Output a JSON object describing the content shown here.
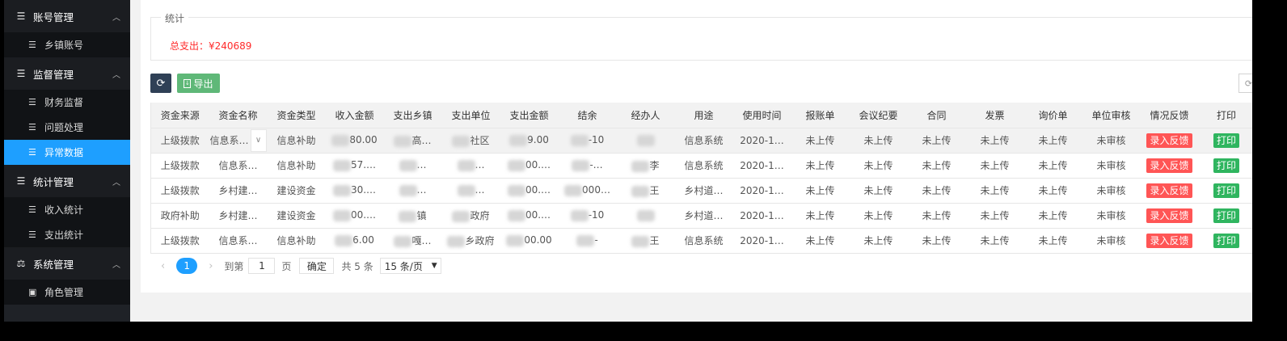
{
  "sidebar": {
    "groups": [
      {
        "label": "账号管理",
        "icon": "list-icon",
        "items": [
          {
            "label": "乡镇账号"
          }
        ]
      },
      {
        "label": "监督管理",
        "icon": "list-icon",
        "items": [
          {
            "label": "财务监督"
          },
          {
            "label": "问题处理"
          },
          {
            "label": "异常数据",
            "active": true
          }
        ]
      },
      {
        "label": "统计管理",
        "icon": "list-icon",
        "items": [
          {
            "label": "收入统计"
          },
          {
            "label": "支出统计"
          }
        ]
      },
      {
        "label": "系统管理",
        "icon": "balance-scale-icon",
        "items": [
          {
            "label": "角色管理"
          }
        ]
      }
    ]
  },
  "stats": {
    "legend": "统计",
    "total_expense": "总支出：¥240689"
  },
  "toolbar": {
    "export_label": "导出"
  },
  "table": {
    "columns": [
      "资金来源",
      "资金名称",
      "资金类型",
      "收入金额",
      "支出乡镇",
      "支出单位",
      "支出金额",
      "结余",
      "经办人",
      "用途",
      "使用时间",
      "报账单",
      "会议纪要",
      "合同",
      "发票",
      "询价单",
      "单位审核",
      "情况反馈",
      "打印"
    ],
    "rows": [
      [
        "上级拨款",
        "信息系…",
        "信息补助",
        "80.00",
        "高…",
        "社区",
        "9.00",
        "-10",
        "",
        "信息系统",
        "2020-1…",
        "未上传",
        "未上传",
        "未上传",
        "未上传",
        "未上传",
        "未审核",
        "录入反馈",
        "打印"
      ],
      [
        "上级拨款",
        "信息系…",
        "信息补助",
        "57.…",
        "…",
        "…",
        "00.…",
        "-…",
        "李",
        "信息系统",
        "2020-1…",
        "未上传",
        "未上传",
        "未上传",
        "未上传",
        "未上传",
        "未审核",
        "录入反馈",
        "打印"
      ],
      [
        "上级拨款",
        "乡村建…",
        "建设资金",
        "30.…",
        "…",
        "…",
        "00.…",
        "000…",
        "王",
        "乡村道…",
        "2020-1…",
        "未上传",
        "未上传",
        "未上传",
        "未上传",
        "未上传",
        "未审核",
        "录入反馈",
        "打印"
      ],
      [
        "政府补助",
        "乡村建…",
        "建设资金",
        "00.…",
        "镇",
        "政府",
        "00.…",
        "-10",
        "",
        "乡村道…",
        "2020-1…",
        "未上传",
        "未上传",
        "未上传",
        "未上传",
        "未上传",
        "未审核",
        "录入反馈",
        "打印"
      ],
      [
        "上级拨款",
        "信息系…",
        "信息补助",
        "6.00",
        "嘎…",
        "乡政府",
        "00.00",
        "-",
        "王",
        "信息系统",
        "2020-1…",
        "未上传",
        "未上传",
        "未上传",
        "未上传",
        "未上传",
        "未审核",
        "录入反馈",
        "打印"
      ]
    ]
  },
  "pager": {
    "current": "1",
    "goto_label": "到第",
    "goto_value": "1",
    "page_unit": "页",
    "confirm_label": "确定",
    "total_label": "共 5 条",
    "page_size": "15 条/页"
  },
  "colors": {
    "sidebar_bg": "#1f2227",
    "active": "#1e9fff",
    "total_text": "#ff2b2b",
    "feedback": "#ff5555",
    "print": "#2fb55f",
    "refresh": "#2f4056",
    "export": "#5fb878"
  }
}
